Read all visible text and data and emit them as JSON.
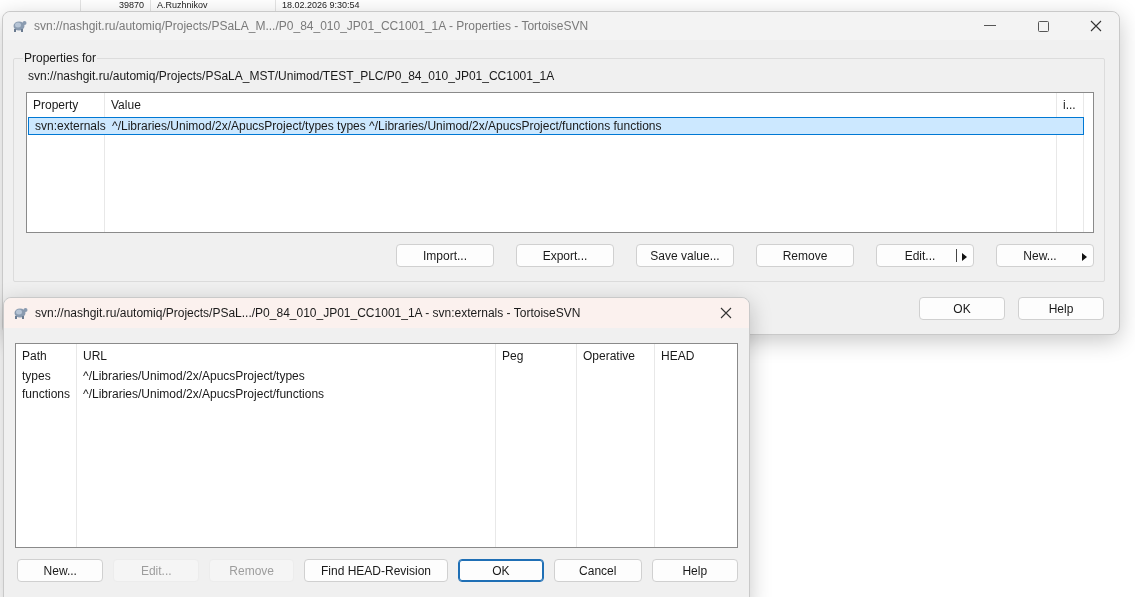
{
  "background_row": {
    "cells": [
      "39870",
      "A.Ruzhnikov",
      "18.02.2026 9:30:54"
    ]
  },
  "properties_window": {
    "title": "svn://nashgit.ru/automiq/Projects/PSaLA_M.../P0_84_010_JP01_CC1001_1A - Properties - TortoiseSVN",
    "active": false,
    "group_label": "Properties for",
    "path": "svn://nashgit.ru/automiq/Projects/PSaLA_MST/Unimod/TEST_PLC/P0_84_010_JP01_CC1001_1A",
    "columns": [
      "Property",
      "Value",
      "i..."
    ],
    "rows": [
      {
        "cells": [
          "svn:externals",
          "^/Libraries/Unimod/2x/ApucsProject/types types ^/Libraries/Unimod/2x/ApucsProject/functions functions"
        ],
        "selected": true
      }
    ],
    "buttons": [
      {
        "label": "Import...",
        "kind": "plain"
      },
      {
        "label": "Export...",
        "kind": "plain"
      },
      {
        "label": "Save value...",
        "kind": "plain"
      },
      {
        "label": "Remove",
        "kind": "plain"
      },
      {
        "label": "Edit...",
        "kind": "split"
      },
      {
        "label": "New...",
        "kind": "menu"
      }
    ],
    "dialog_buttons": [
      {
        "label": "OK"
      },
      {
        "label": "Help"
      }
    ]
  },
  "externals_dialog": {
    "title": "svn://nashgit.ru/automiq/Projects/PSaL.../P0_84_010_JP01_CC1001_1A - svn:externals - TortoiseSVN",
    "active": true,
    "columns": [
      "Path",
      "URL",
      "Peg",
      "Operative",
      "HEAD"
    ],
    "rows": [
      {
        "cells": [
          "types",
          "^/Libraries/Unimod/2x/ApucsProject/types"
        ]
      },
      {
        "cells": [
          "functions",
          "^/Libraries/Unimod/2x/ApucsProject/functions"
        ]
      }
    ],
    "buttons": [
      {
        "label": "New...",
        "disabled": false,
        "default": false
      },
      {
        "label": "Edit...",
        "disabled": true,
        "default": false
      },
      {
        "label": "Remove",
        "disabled": true,
        "default": false
      },
      {
        "label": "Find HEAD-Revision",
        "disabled": false,
        "default": false
      },
      {
        "label": "OK",
        "disabled": false,
        "default": true
      },
      {
        "label": "Cancel",
        "disabled": false,
        "default": false
      },
      {
        "label": "Help",
        "disabled": false,
        "default": false
      }
    ]
  }
}
